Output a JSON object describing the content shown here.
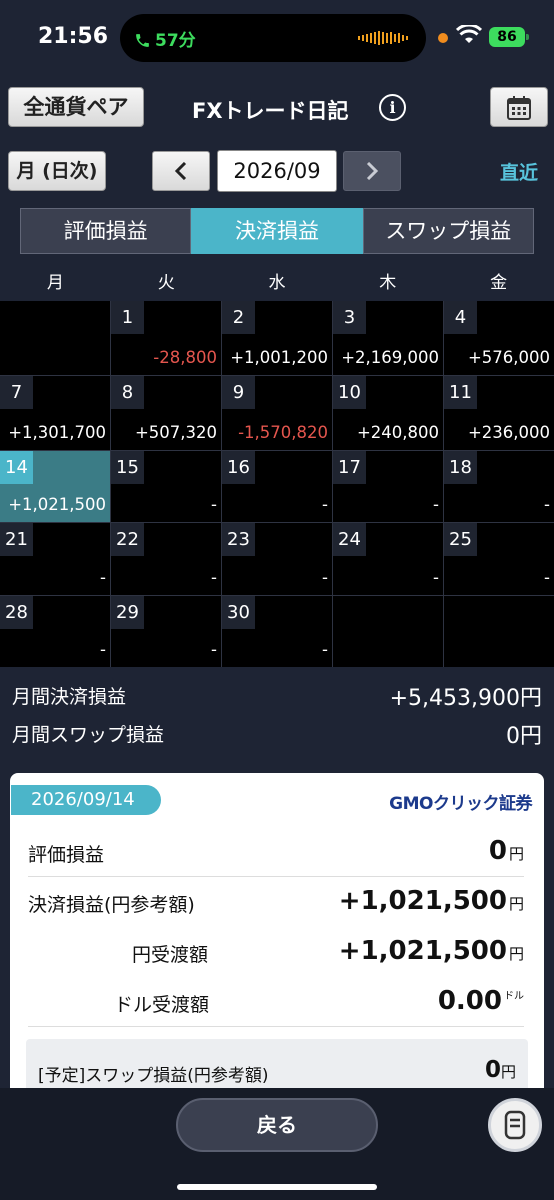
{
  "status": {
    "time": "21:56",
    "call": "57分",
    "battery": "86"
  },
  "header": {
    "pair_button": "全通貨ペア",
    "title": "FXトレード日記",
    "info": "i"
  },
  "toolbar": {
    "period_button": "月 (日次)",
    "month": "2026/09",
    "recent": "直近"
  },
  "tabs": [
    {
      "label": "評価損益",
      "active": false
    },
    {
      "label": "決済損益",
      "active": true
    },
    {
      "label": "スワップ損益",
      "active": false
    }
  ],
  "weekdays": [
    "月",
    "火",
    "水",
    "木",
    "金"
  ],
  "calendar": [
    [
      null,
      {
        "day": "1",
        "value": "-28,800"
      },
      {
        "day": "2",
        "value": "+1,001,200"
      },
      {
        "day": "3",
        "value": "+2,169,000"
      },
      {
        "day": "4",
        "value": "+576,000"
      }
    ],
    [
      {
        "day": "7",
        "value": "+1,301,700"
      },
      {
        "day": "8",
        "value": "+507,320"
      },
      {
        "day": "9",
        "value": "-1,570,820"
      },
      {
        "day": "10",
        "value": "+240,800"
      },
      {
        "day": "11",
        "value": "+236,000"
      }
    ],
    [
      {
        "day": "14",
        "value": "+1,021,500",
        "today": true
      },
      {
        "day": "15",
        "value": "-"
      },
      {
        "day": "16",
        "value": "-"
      },
      {
        "day": "17",
        "value": "-"
      },
      {
        "day": "18",
        "value": "-"
      }
    ],
    [
      {
        "day": "21",
        "value": "-"
      },
      {
        "day": "22",
        "value": "-"
      },
      {
        "day": "23",
        "value": "-"
      },
      {
        "day": "24",
        "value": "-"
      },
      {
        "day": "25",
        "value": "-"
      }
    ],
    [
      {
        "day": "28",
        "value": "-"
      },
      {
        "day": "29",
        "value": "-"
      },
      {
        "day": "30",
        "value": "-"
      },
      null,
      null
    ]
  ],
  "summary": {
    "settlement_label": "月間決済損益",
    "settlement_value": "+5,453,900円",
    "swap_label": "月間スワップ損益",
    "swap_value": "0円"
  },
  "detail": {
    "date": "2026/09/14",
    "broker_logo": "GMOクリック証券",
    "unrealized_label": "評価損益",
    "unrealized_value": "0",
    "unrealized_unit": "円",
    "settlement_label": "決済損益(円参考額)",
    "settlement_value": "+1,021,500",
    "settlement_unit": "円",
    "jpy_label": "円受渡額",
    "jpy_value": "+1,021,500",
    "jpy_unit": "円",
    "usd_label": "ドル受渡額",
    "usd_value": "0.00",
    "usd_unit": "ドル",
    "swap_label": "[予定]スワップ損益(円参考額)",
    "swap_value": "0",
    "swap_unit": "円"
  },
  "bottom": {
    "back_button": "戻る"
  }
}
